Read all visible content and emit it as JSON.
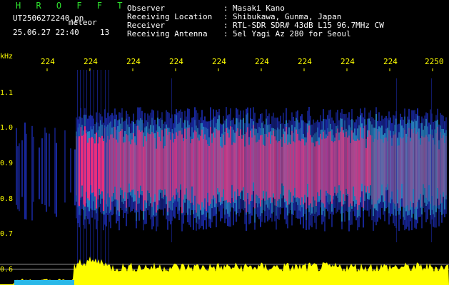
{
  "header": {
    "brand": "H R O F F T",
    "filename": "UT2506272240.pn",
    "mode": "meteor",
    "datetime": "25.06.27 22:40",
    "count": "13",
    "info": [
      {
        "label": "Observer",
        "value": "Masaki Kano"
      },
      {
        "label": "Receiving Location",
        "value": "Shibukawa, Gunma, Japan"
      },
      {
        "label": "Receiver",
        "value": "RTL-SDR SDR# 43dB L15 96.7MHz CW"
      },
      {
        "label": "Receiving Antenna",
        "value": "5el Yagi Az 280 for Seoul"
      }
    ],
    "separator": ":"
  },
  "axes": {
    "y_unit": "kHz",
    "y_ticks": [
      "1.1",
      "1.0",
      "0.9",
      "0.8",
      "0.7",
      "0.6"
    ],
    "x_ticks": [
      "224",
      "224",
      "224",
      "224",
      "224",
      "224",
      "224",
      "224",
      "224",
      "2250"
    ]
  },
  "colors": {
    "background": "#000000",
    "axis_text": "#ffff00",
    "brand": "#2ee02e",
    "signal_low": "#1a2aa8",
    "signal_mid": "#33c0e0",
    "signal_high": "#ff2a78",
    "power": "#ffff00"
  }
}
